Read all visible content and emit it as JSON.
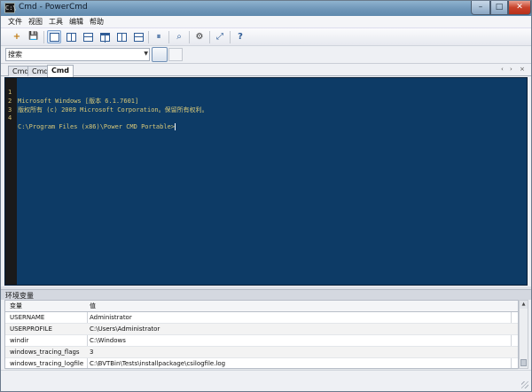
{
  "window": {
    "title": "Cmd - PowerCmd",
    "app_icon_glyph": "C:\\"
  },
  "menubar": {
    "items": [
      "文件",
      "视图",
      "工具",
      "编辑",
      "帮助"
    ]
  },
  "search": {
    "value": "搜索",
    "dropdown_glyph": "▼"
  },
  "tabs": {
    "items": [
      "Cmd",
      "Cmd",
      "Cmd"
    ],
    "active_index": 2
  },
  "console": {
    "lines": [
      {
        "num": "1",
        "text": "Microsoft Windows [版本 6.1.7601]"
      },
      {
        "num": "2",
        "text": "版权所有 (c) 2009 Microsoft Corporation。保留所有权利。"
      },
      {
        "num": "3",
        "text": ""
      },
      {
        "num": "4",
        "text": "C:\\Program Files (x86)\\Power CMD Portable>"
      }
    ],
    "background": "#0d3b66",
    "text_color": "#d8c878"
  },
  "env_panel": {
    "title": "环境变量",
    "headers": {
      "key": "变量",
      "value": "值"
    },
    "rows": [
      {
        "key": "USERNAME",
        "value": "Administrator"
      },
      {
        "key": "USERPROFILE",
        "value": "C:\\Users\\Administrator"
      },
      {
        "key": "windir",
        "value": "C:\\Windows"
      },
      {
        "key": "windows_tracing_flags",
        "value": "3"
      },
      {
        "key": "windows_tracing_logfile",
        "value": "C:\\BVTBin\\Tests\\installpackage\\csilogfile.log"
      }
    ]
  },
  "icons": {
    "new_tab": "+",
    "save": "💾",
    "pause": "⏸",
    "find": "⌕",
    "settings": "⚙",
    "fullscreen": "⤢",
    "help": "?",
    "tab_prev": "‹",
    "tab_next": "›",
    "tab_close": "×",
    "scroll_up": "▲",
    "scroll_down": "▼",
    "minimize": "–",
    "maximize": "□",
    "close": "✕"
  }
}
